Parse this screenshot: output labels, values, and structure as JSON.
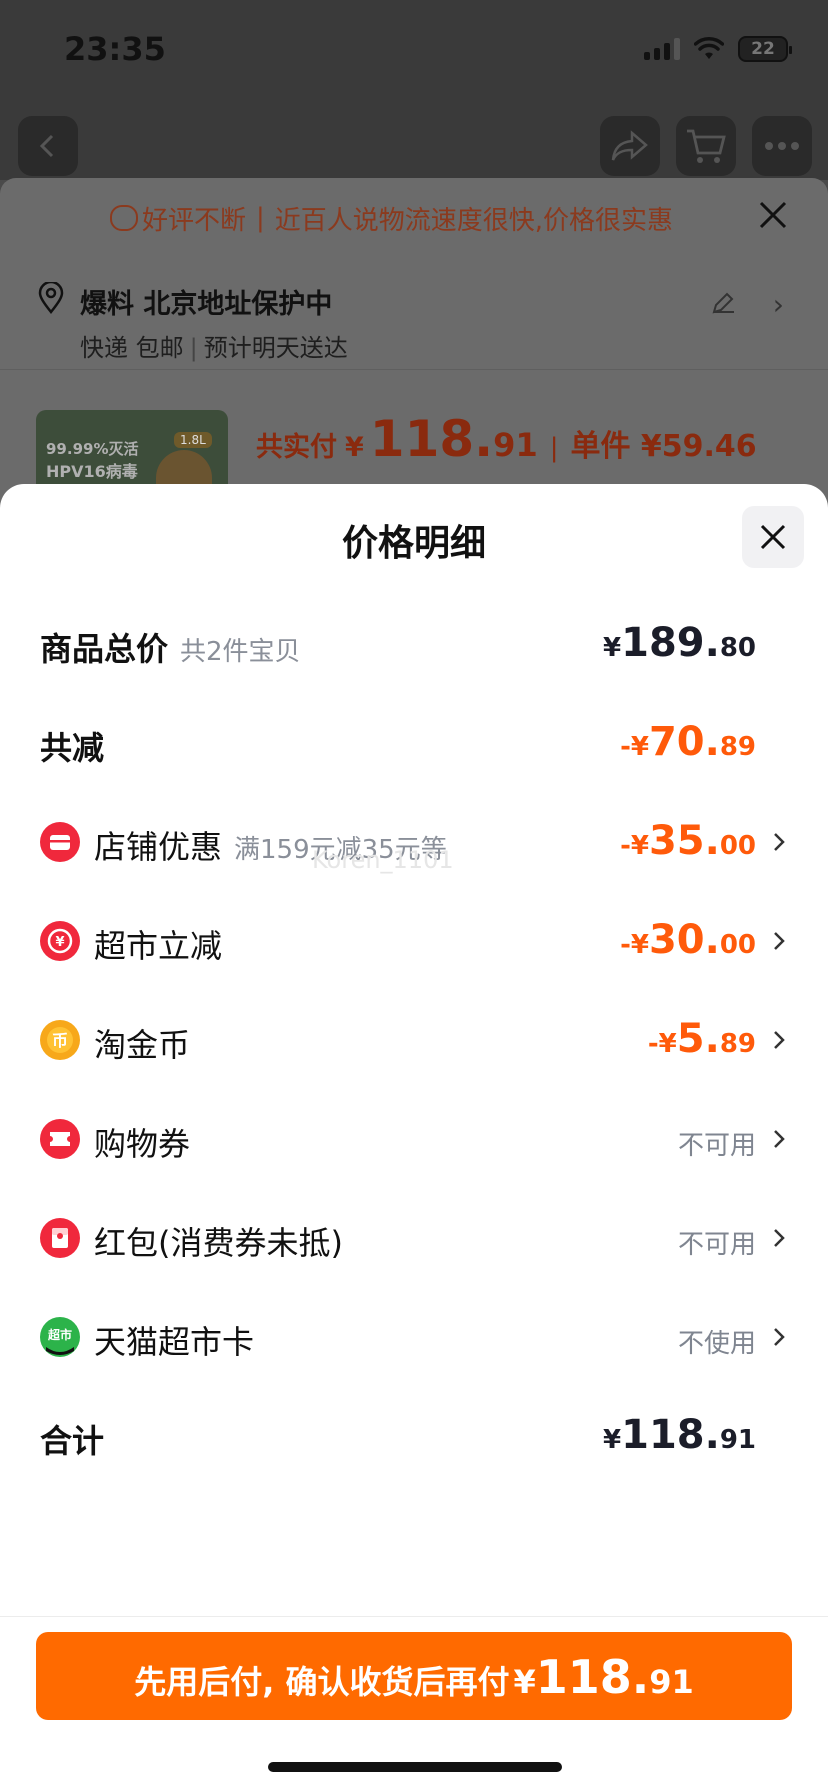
{
  "status_bar": {
    "time": "23:35",
    "battery": "22"
  },
  "background": {
    "banner_text_1": "好评不断",
    "banner_text_2": "近百人说物流速度很快,价格很实惠",
    "address_line": "爆料 北京地址保护中",
    "delivery_a": "快递 包邮",
    "delivery_b": "预计明天送达",
    "product_image_text_1": "99.99%灭活",
    "product_image_text_2": "HPV16病毒",
    "product_image_badge": "1.8L",
    "paid_label": "共实付",
    "paid_yen": "¥",
    "paid_int": "118.",
    "paid_dec": "91",
    "unit_price": "单件 ¥59.46"
  },
  "modal": {
    "title": "价格明细",
    "watermark": "Koren_1101",
    "rows": [
      {
        "label": "商品总价",
        "sub": "共2件宝贝",
        "yen": "¥",
        "int": "189.",
        "dec": "80"
      },
      {
        "label": "共减",
        "yen": "-¥",
        "int": "70.",
        "dec": "89"
      },
      {
        "label": "店铺优惠",
        "sub": "满159元减35元等",
        "yen": "-¥",
        "int": "35.",
        "dec": "00",
        "icon": "shop-discount-icon"
      },
      {
        "label": "超市立减",
        "yen": "-¥",
        "int": "30.",
        "dec": "00",
        "icon": "supermarket-discount-icon"
      },
      {
        "label": "淘金币",
        "yen": "-¥",
        "int": "5.",
        "dec": "89",
        "icon": "gold-coin-icon"
      },
      {
        "label": "购物券",
        "status": "不可用",
        "icon": "shopping-voucher-icon"
      },
      {
        "label": "红包(消费券未抵)",
        "status": "不可用",
        "icon": "red-packet-icon"
      },
      {
        "label": "天猫超市卡",
        "status": "不使用",
        "icon": "tmall-card-icon",
        "icon_text": "超市"
      },
      {
        "label": "合计",
        "yen": "¥",
        "int": "118.",
        "dec": "91"
      }
    ],
    "pay_button": {
      "text": "先用后付, 确认收货后再付",
      "yen": "¥",
      "int": "118.",
      "dec": "91"
    }
  },
  "colors": {
    "accent": "#ff6a00",
    "discount": "#ff5a0a",
    "icon_red": "#f0283c",
    "icon_gold": "#f7a81a",
    "icon_green": "#2cb34a"
  }
}
